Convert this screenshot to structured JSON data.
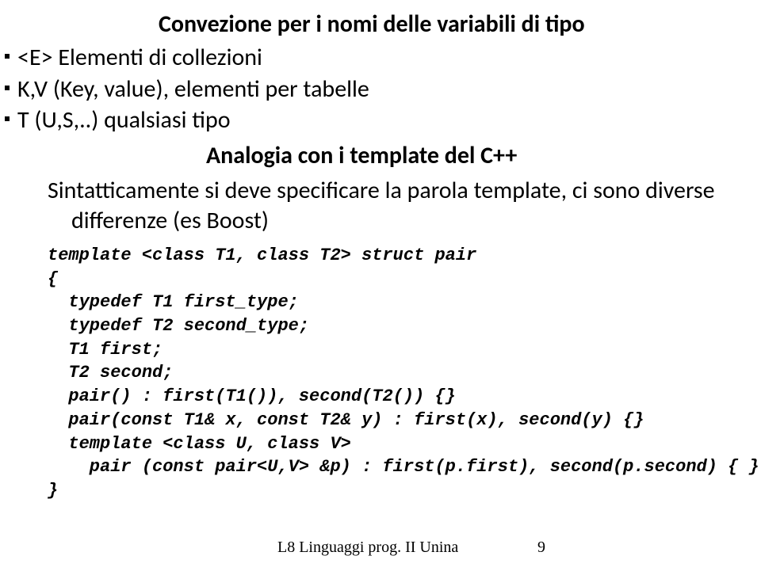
{
  "title": "Convezione per i nomi delle variabili di tipo",
  "bullets": [
    "<E> Elementi di collezioni",
    "K,V (Key, value), elementi per tabelle",
    "T (U,S,..) qualsiasi tipo"
  ],
  "subtitle": "Analogia con i template del C++",
  "paragraph_line1": "Sintatticamente si deve specificare la parola template, ci sono diverse",
  "paragraph_line2": "differenze (es Boost)",
  "code": "template <class T1, class T2> struct pair\n{\n  typedef T1 first_type;\n  typedef T2 second_type;\n  T1 first;\n  T2 second;\n  pair() : first(T1()), second(T2()) {}\n  pair(const T1& x, const T2& y) : first(x), second(y) {}\n  template <class U, class V>\n    pair (const pair<U,V> &p) : first(p.first), second(p.second) { }\n}",
  "footer": {
    "text": "L8 Linguaggi prog. II Unina",
    "page": "9"
  }
}
